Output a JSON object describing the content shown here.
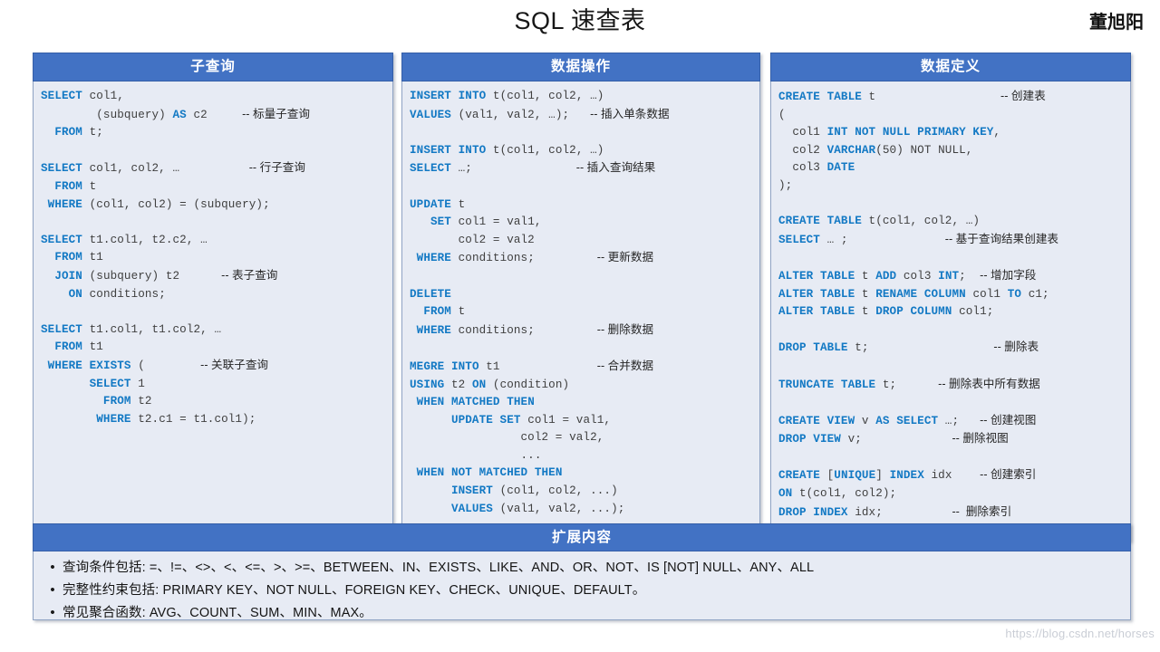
{
  "header": {
    "title": "SQL 速查表",
    "author": "董旭阳"
  },
  "panels": [
    {
      "id": "subquery",
      "title": "子查询",
      "lines": [
        [
          {
            "t": "SELECT",
            "c": "kw"
          },
          {
            "t": " col1,",
            "c": "id"
          }
        ],
        [
          {
            "t": "        (subquery) ",
            "c": "id"
          },
          {
            "t": "AS",
            "c": "kw"
          },
          {
            "t": " c2     ",
            "c": "id"
          },
          {
            "t": "-- 标量子查询",
            "c": "cm"
          }
        ],
        [
          {
            "t": "  ",
            "c": "id"
          },
          {
            "t": "FROM",
            "c": "kw"
          },
          {
            "t": " t;",
            "c": "id"
          }
        ],
        [],
        [
          {
            "t": "SELECT",
            "c": "kw"
          },
          {
            "t": " col1, col2, …          ",
            "c": "id"
          },
          {
            "t": "-- 行子查询",
            "c": "cm"
          }
        ],
        [
          {
            "t": "  ",
            "c": "id"
          },
          {
            "t": "FROM",
            "c": "kw"
          },
          {
            "t": " t",
            "c": "id"
          }
        ],
        [
          {
            "t": " ",
            "c": "id"
          },
          {
            "t": "WHERE",
            "c": "kw"
          },
          {
            "t": " (col1, col2) = (subquery);",
            "c": "id"
          }
        ],
        [],
        [
          {
            "t": "SELECT",
            "c": "kw"
          },
          {
            "t": " t1.col1, t2.c2, …",
            "c": "id"
          }
        ],
        [
          {
            "t": "  ",
            "c": "id"
          },
          {
            "t": "FROM",
            "c": "kw"
          },
          {
            "t": " t1",
            "c": "id"
          }
        ],
        [
          {
            "t": "  ",
            "c": "id"
          },
          {
            "t": "JOIN",
            "c": "kw"
          },
          {
            "t": " (subquery) t2      ",
            "c": "id"
          },
          {
            "t": "-- 表子查询",
            "c": "cm"
          }
        ],
        [
          {
            "t": "    ",
            "c": "id"
          },
          {
            "t": "ON",
            "c": "kw"
          },
          {
            "t": " conditions;",
            "c": "id"
          }
        ],
        [],
        [
          {
            "t": "SELECT",
            "c": "kw"
          },
          {
            "t": " t1.col1, t1.col2, …",
            "c": "id"
          }
        ],
        [
          {
            "t": "  ",
            "c": "id"
          },
          {
            "t": "FROM",
            "c": "kw"
          },
          {
            "t": " t1",
            "c": "id"
          }
        ],
        [
          {
            "t": " ",
            "c": "id"
          },
          {
            "t": "WHERE",
            "c": "kw"
          },
          {
            "t": " ",
            "c": "id"
          },
          {
            "t": "EXISTS",
            "c": "kw"
          },
          {
            "t": " (        ",
            "c": "id"
          },
          {
            "t": "-- 关联子查询",
            "c": "cm"
          }
        ],
        [
          {
            "t": "       ",
            "c": "id"
          },
          {
            "t": "SELECT",
            "c": "kw"
          },
          {
            "t": " 1",
            "c": "id"
          }
        ],
        [
          {
            "t": "         ",
            "c": "id"
          },
          {
            "t": "FROM",
            "c": "kw"
          },
          {
            "t": " t2",
            "c": "id"
          }
        ],
        [
          {
            "t": "        ",
            "c": "id"
          },
          {
            "t": "WHERE",
            "c": "kw"
          },
          {
            "t": " t2.c1 = t1.col1);",
            "c": "id"
          }
        ]
      ]
    },
    {
      "id": "dml",
      "title": "数据操作",
      "lines": [
        [
          {
            "t": "INSERT",
            "c": "kw"
          },
          {
            "t": " ",
            "c": "id"
          },
          {
            "t": "INTO",
            "c": "kw"
          },
          {
            "t": " t(col1, col2, …)",
            "c": "id"
          }
        ],
        [
          {
            "t": "VALUES",
            "c": "kw"
          },
          {
            "t": " (val1, val2, …);   ",
            "c": "id"
          },
          {
            "t": "-- 插入单条数据",
            "c": "cm"
          }
        ],
        [],
        [
          {
            "t": "INSERT",
            "c": "kw"
          },
          {
            "t": " ",
            "c": "id"
          },
          {
            "t": "INTO",
            "c": "kw"
          },
          {
            "t": " t(col1, col2, …)",
            "c": "id"
          }
        ],
        [
          {
            "t": "SELECT",
            "c": "kw"
          },
          {
            "t": " …;               ",
            "c": "id"
          },
          {
            "t": "-- 插入查询结果",
            "c": "cm"
          }
        ],
        [],
        [
          {
            "t": "UPDATE",
            "c": "kw"
          },
          {
            "t": " t",
            "c": "id"
          }
        ],
        [
          {
            "t": "   ",
            "c": "id"
          },
          {
            "t": "SET",
            "c": "kw"
          },
          {
            "t": " col1 = val1,",
            "c": "id"
          }
        ],
        [
          {
            "t": "       col2 = val2",
            "c": "id"
          }
        ],
        [
          {
            "t": " ",
            "c": "id"
          },
          {
            "t": "WHERE",
            "c": "kw"
          },
          {
            "t": " conditions;         ",
            "c": "id"
          },
          {
            "t": "-- 更新数据",
            "c": "cm"
          }
        ],
        [],
        [
          {
            "t": "DELETE",
            "c": "kw"
          }
        ],
        [
          {
            "t": "  ",
            "c": "id"
          },
          {
            "t": "FROM",
            "c": "kw"
          },
          {
            "t": " t",
            "c": "id"
          }
        ],
        [
          {
            "t": " ",
            "c": "id"
          },
          {
            "t": "WHERE",
            "c": "kw"
          },
          {
            "t": " conditions;         ",
            "c": "id"
          },
          {
            "t": "-- 删除数据",
            "c": "cm"
          }
        ],
        [],
        [
          {
            "t": "MEGRE",
            "c": "kw"
          },
          {
            "t": " ",
            "c": "id"
          },
          {
            "t": "INTO",
            "c": "kw"
          },
          {
            "t": " t1              ",
            "c": "id"
          },
          {
            "t": "-- 合并数据",
            "c": "cm"
          }
        ],
        [
          {
            "t": "USING",
            "c": "kw"
          },
          {
            "t": " t2 ",
            "c": "id"
          },
          {
            "t": "ON",
            "c": "kw"
          },
          {
            "t": " (condition)",
            "c": "id"
          }
        ],
        [
          {
            "t": " ",
            "c": "id"
          },
          {
            "t": "WHEN MATCHED THEN",
            "c": "kw"
          }
        ],
        [
          {
            "t": "      ",
            "c": "id"
          },
          {
            "t": "UPDATE SET",
            "c": "kw"
          },
          {
            "t": " col1 = val1,",
            "c": "id"
          }
        ],
        [
          {
            "t": "                col2 = val2,",
            "c": "id"
          }
        ],
        [
          {
            "t": "                ...",
            "c": "id"
          }
        ],
        [
          {
            "t": " ",
            "c": "id"
          },
          {
            "t": "WHEN NOT MATCHED THEN",
            "c": "kw"
          }
        ],
        [
          {
            "t": "      ",
            "c": "id"
          },
          {
            "t": "INSERT",
            "c": "kw"
          },
          {
            "t": " (col1, col2, ...)",
            "c": "id"
          }
        ],
        [
          {
            "t": "      ",
            "c": "id"
          },
          {
            "t": "VALUES",
            "c": "kw"
          },
          {
            "t": " (val1, val2, ...);",
            "c": "id"
          }
        ]
      ]
    },
    {
      "id": "ddl",
      "title": "数据定义",
      "lines": [
        [
          {
            "t": "CREATE TABLE",
            "c": "kw"
          },
          {
            "t": " t                  ",
            "c": "id"
          },
          {
            "t": "-- 创建表",
            "c": "cm"
          }
        ],
        [
          {
            "t": "(",
            "c": "id"
          }
        ],
        [
          {
            "t": "  col1 ",
            "c": "id"
          },
          {
            "t": "INT NOT NULL PRIMARY KEY",
            "c": "kw"
          },
          {
            "t": ",",
            "c": "id"
          }
        ],
        [
          {
            "t": "  col2 ",
            "c": "id"
          },
          {
            "t": "VARCHAR",
            "c": "kw"
          },
          {
            "t": "(50) NOT NULL,",
            "c": "id"
          }
        ],
        [
          {
            "t": "  col3 ",
            "c": "id"
          },
          {
            "t": "DATE",
            "c": "kw"
          }
        ],
        [
          {
            "t": ");",
            "c": "id"
          }
        ],
        [],
        [
          {
            "t": "CREATE TABLE",
            "c": "kw"
          },
          {
            "t": " t(col1, col2, …)",
            "c": "id"
          }
        ],
        [
          {
            "t": "SELECT",
            "c": "kw"
          },
          {
            "t": " … ;              ",
            "c": "id"
          },
          {
            "t": "-- 基于查询结果创建表",
            "c": "cm"
          }
        ],
        [],
        [
          {
            "t": "ALTER TABLE",
            "c": "kw"
          },
          {
            "t": " t ",
            "c": "id"
          },
          {
            "t": "ADD",
            "c": "kw"
          },
          {
            "t": " col3 ",
            "c": "id"
          },
          {
            "t": "INT",
            "c": "kw"
          },
          {
            "t": ";  ",
            "c": "id"
          },
          {
            "t": "-- 增加字段",
            "c": "cm"
          }
        ],
        [
          {
            "t": "ALTER TABLE",
            "c": "kw"
          },
          {
            "t": " t ",
            "c": "id"
          },
          {
            "t": "RENAME COLUMN",
            "c": "kw"
          },
          {
            "t": " col1 ",
            "c": "id"
          },
          {
            "t": "TO",
            "c": "kw"
          },
          {
            "t": " c1;",
            "c": "id"
          }
        ],
        [
          {
            "t": "ALTER TABLE",
            "c": "kw"
          },
          {
            "t": " t ",
            "c": "id"
          },
          {
            "t": "DROP COLUMN",
            "c": "kw"
          },
          {
            "t": " col1;",
            "c": "id"
          }
        ],
        [],
        [
          {
            "t": "DROP TABLE",
            "c": "kw"
          },
          {
            "t": " t;                  ",
            "c": "id"
          },
          {
            "t": "-- 删除表",
            "c": "cm"
          }
        ],
        [],
        [
          {
            "t": "TRUNCATE TABLE",
            "c": "kw"
          },
          {
            "t": " t;      ",
            "c": "id"
          },
          {
            "t": "-- 删除表中所有数据",
            "c": "cm"
          }
        ],
        [],
        [
          {
            "t": "CREATE VIEW",
            "c": "kw"
          },
          {
            "t": " v ",
            "c": "id"
          },
          {
            "t": "AS SELECT",
            "c": "kw"
          },
          {
            "t": " …;   ",
            "c": "id"
          },
          {
            "t": "-- 创建视图",
            "c": "cm"
          }
        ],
        [
          {
            "t": "DROP VIEW",
            "c": "kw"
          },
          {
            "t": " v;             ",
            "c": "id"
          },
          {
            "t": "-- 删除视图",
            "c": "cm"
          }
        ],
        [],
        [
          {
            "t": "CREATE",
            "c": "kw"
          },
          {
            "t": " [",
            "c": "id"
          },
          {
            "t": "UNIQUE",
            "c": "kw"
          },
          {
            "t": "] ",
            "c": "id"
          },
          {
            "t": "INDEX",
            "c": "kw"
          },
          {
            "t": " idx    ",
            "c": "id"
          },
          {
            "t": "-- 创建索引",
            "c": "cm"
          }
        ],
        [
          {
            "t": "ON",
            "c": "kw"
          },
          {
            "t": " t(col1, col2);",
            "c": "id"
          }
        ],
        [
          {
            "t": "DROP INDEX",
            "c": "kw"
          },
          {
            "t": " idx;          ",
            "c": "id"
          },
          {
            "t": "--  删除索引",
            "c": "cm"
          }
        ]
      ]
    }
  ],
  "extra": {
    "title": "扩展内容",
    "bullet_marker": "•",
    "items": [
      "查询条件包括: =、!=、<>、<、<=、>、>=、BETWEEN、IN、EXISTS、LIKE、AND、OR、NOT、IS [NOT] NULL、ANY、ALL",
      "完整性约束包括: PRIMARY KEY、NOT NULL、FOREIGN KEY、CHECK、UNIQUE、DEFAULT。",
      "常见聚合函数: AVG、COUNT、SUM、MIN、MAX。"
    ]
  },
  "watermark": "https://blog.csdn.net/horses",
  "colors": {
    "header_blue": "#4272C4",
    "body_bg": "#E7EBF4",
    "border": "#8FA3C4",
    "keyword": "#1379C4",
    "identifier": "#3F3F3F"
  }
}
